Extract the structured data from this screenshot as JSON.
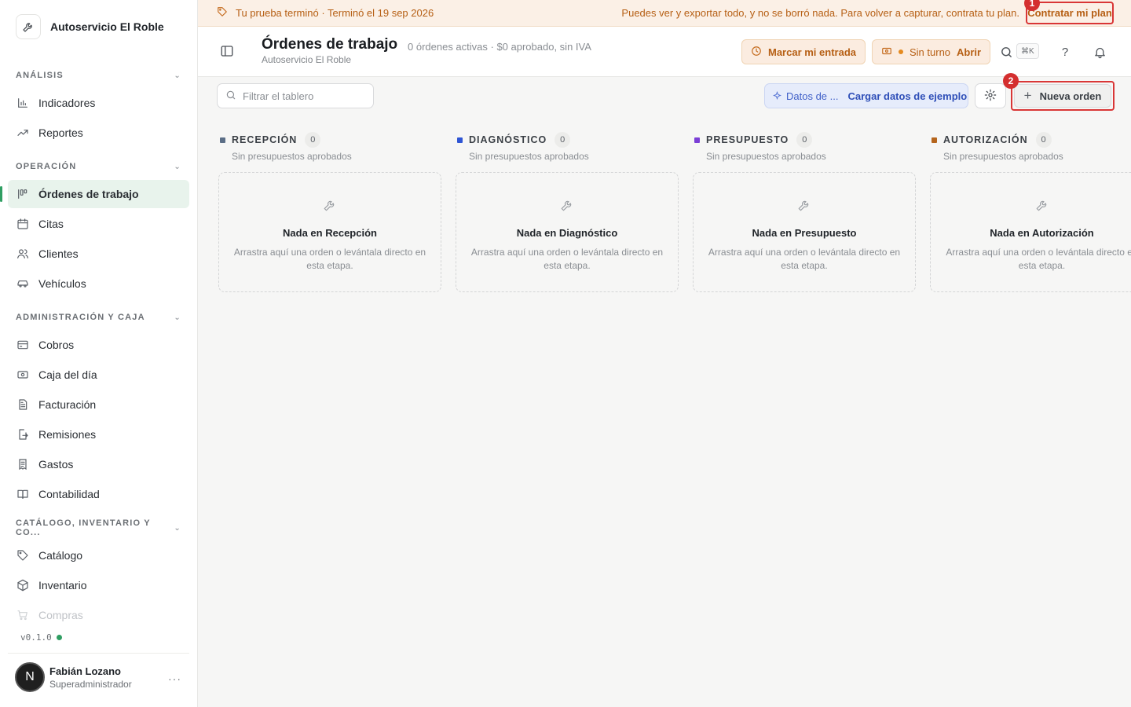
{
  "brand": {
    "name": "Autoservicio El Roble"
  },
  "sidebar": {
    "sections": [
      {
        "title": "ANÁLISIS",
        "items": [
          {
            "label": "Indicadores",
            "icon": "bar-chart-icon"
          },
          {
            "label": "Reportes",
            "icon": "trend-icon"
          }
        ]
      },
      {
        "title": "OPERACIÓN",
        "items": [
          {
            "label": "Órdenes de trabajo",
            "icon": "kanban-icon",
            "active": true
          },
          {
            "label": "Citas",
            "icon": "calendar-icon"
          },
          {
            "label": "Clientes",
            "icon": "users-icon"
          },
          {
            "label": "Vehículos",
            "icon": "car-icon"
          }
        ]
      },
      {
        "title": "ADMINISTRACIÓN Y CAJA",
        "items": [
          {
            "label": "Cobros",
            "icon": "card-icon"
          },
          {
            "label": "Caja del día",
            "icon": "cash-icon"
          },
          {
            "label": "Facturación",
            "icon": "invoice-icon"
          },
          {
            "label": "Remisiones",
            "icon": "file-arrow-icon"
          },
          {
            "label": "Gastos",
            "icon": "receipt-icon"
          },
          {
            "label": "Contabilidad",
            "icon": "book-icon"
          }
        ]
      },
      {
        "title": "CATÁLOGO, INVENTARIO Y CO...",
        "items": [
          {
            "label": "Catálogo",
            "icon": "tag-icon"
          },
          {
            "label": "Inventario",
            "icon": "box-icon"
          },
          {
            "label": "Compras",
            "icon": "cart-icon",
            "faded": true
          }
        ]
      }
    ],
    "version": "v0.1.0",
    "user": {
      "initial": "N",
      "name": "Fabián Lozano",
      "role": "Superadministrador",
      "more": "···"
    }
  },
  "banner": {
    "left": "Tu prueba terminó · Terminó el 19 sep 2026",
    "right": "Puedes ver y exportar todo, y no se borró nada. Para volver a capturar, contrata tu plan.",
    "cta": "Contratar mi plan",
    "marker": "1"
  },
  "header": {
    "title": "Órdenes de trabajo",
    "subtitle": "Autoservicio El Roble",
    "meta": "0 órdenes activas · $0 aprobado, sin IVA",
    "checkin": "Marcar mi entrada",
    "shift_status": "Sin turno",
    "shift_action": "Abrir",
    "kbd": "⌘K",
    "help": "?"
  },
  "toolbar": {
    "filter_placeholder": "Filtrar el tablero",
    "sample_prefix": "Datos de ...",
    "sample_action": "Cargar datos de ejemplo",
    "new_order": "Nueva orden",
    "marker": "2"
  },
  "board": {
    "columns": [
      {
        "title": "RECEPCIÓN",
        "count": "0",
        "sub": "Sin presupuestos aprobados",
        "empty_title": "Nada en Recepción",
        "empty_text": "Arrastra aquí una orden o levántala directo en esta etapa.",
        "color": "#5b6e86"
      },
      {
        "title": "DIAGNÓSTICO",
        "count": "0",
        "sub": "Sin presupuestos aprobados",
        "empty_title": "Nada en Diagnóstico",
        "empty_text": "Arrastra aquí una orden o levántala directo en esta etapa.",
        "color": "#2f55d4"
      },
      {
        "title": "PRESUPUESTO",
        "count": "0",
        "sub": "Sin presupuestos aprobados",
        "empty_title": "Nada en Presupuesto",
        "empty_text": "Arrastra aquí una orden o levántala directo en esta etapa.",
        "color": "#7b3fd6"
      },
      {
        "title": "AUTORIZACIÓN",
        "count": "0",
        "sub": "Sin presupuestos aprobados",
        "empty_title": "Nada en Autorización",
        "empty_text": "Arrastra aquí una orden o levántala directo en esta etapa.",
        "color": "#b5651d"
      }
    ]
  }
}
